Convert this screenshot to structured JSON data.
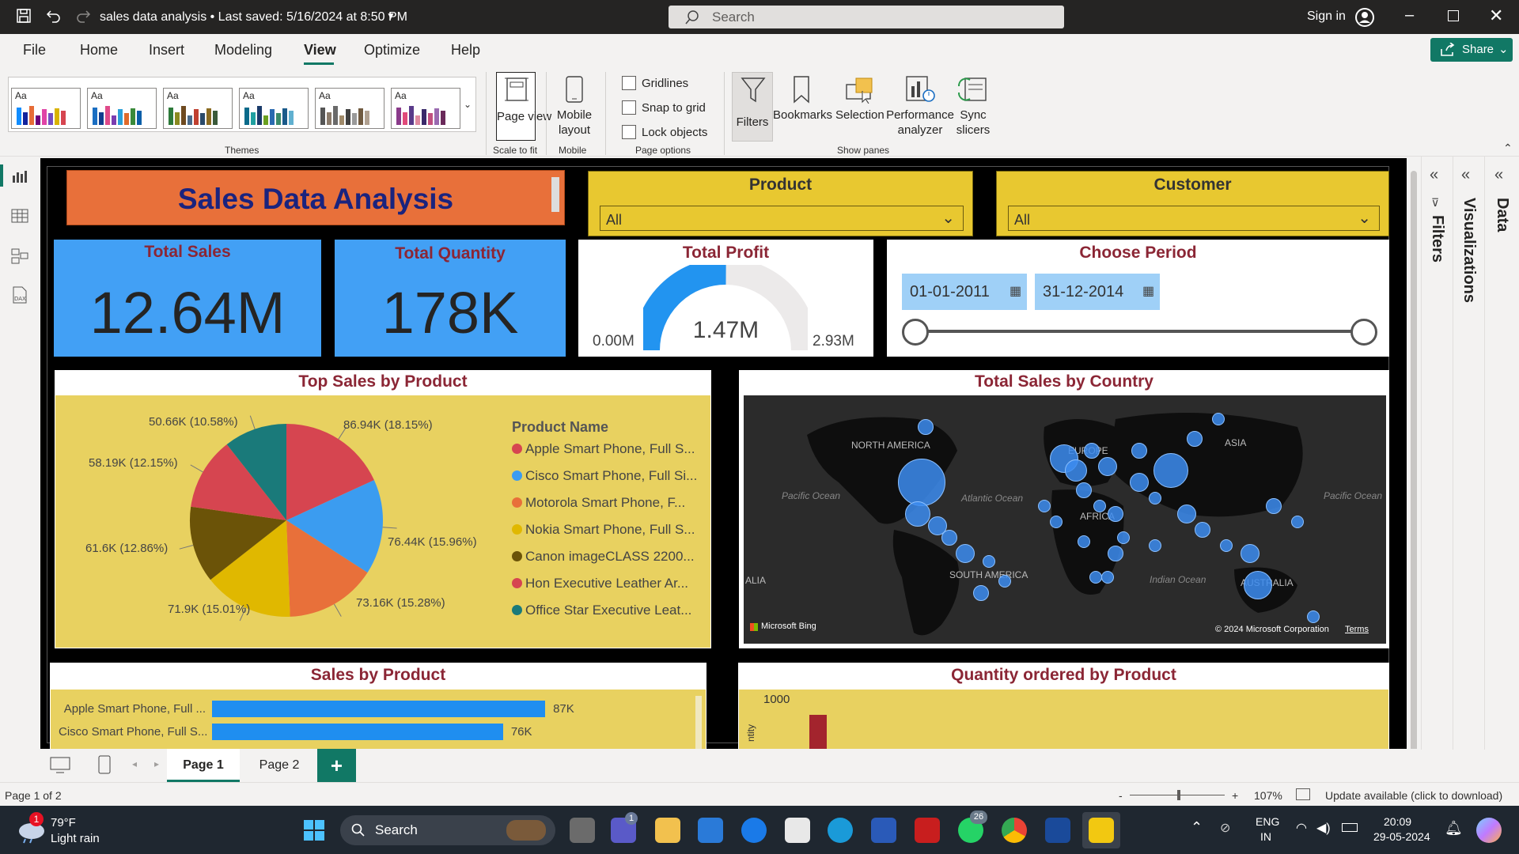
{
  "titlebar": {
    "title": "sales data analysis  •  Last saved: 5/16/2024 at 8:50 PM",
    "search_placeholder": "Search",
    "signin": "Sign in"
  },
  "menu": {
    "items": [
      "File",
      "Home",
      "Insert",
      "Modeling",
      "View",
      "Optimize",
      "Help"
    ],
    "share": "Share"
  },
  "ribbon": {
    "themes_label": "Themes",
    "theme_aa": "Aa",
    "page_view": "Page view",
    "scale_to_fit": "Scale to fit",
    "mobile_layout": "Mobile layout",
    "mobile": "Mobile",
    "gridlines": "Gridlines",
    "snap_to_grid": "Snap to grid",
    "lock_objects": "Lock objects",
    "page_options": "Page options",
    "filters": "Filters",
    "bookmarks": "Bookmarks",
    "selection": "Selection",
    "performance_analyzer": "Performance analyzer",
    "sync_slicers": "Sync slicers",
    "show_panes": "Show panes"
  },
  "report": {
    "title": "Sales Data Analysis",
    "product_slicer": {
      "label": "Product",
      "value": "All"
    },
    "customer_slicer": {
      "label": "Customer",
      "value": "All"
    },
    "total_sales": {
      "label": "Total Sales",
      "value": "12.64M"
    },
    "total_quantity": {
      "label": "Total Quantity",
      "value": "178K"
    },
    "total_profit": {
      "label": "Total Profit",
      "value": "1.47M",
      "min": "0.00M",
      "max": "2.93M",
      "fraction": 0.502
    },
    "period": {
      "label": "Choose Period",
      "start": "01-01-2011",
      "end": "31-12-2014"
    },
    "top_sales": {
      "title": "Top Sales by Product",
      "legend_title": "Product Name"
    },
    "map": {
      "title": "Total Sales by Country",
      "labels": [
        "NORTH AMERICA",
        "EUROPE",
        "ASIA",
        "AFRICA",
        "SOUTH AMERICA",
        "AUSTRALIA",
        "Pacific Ocean",
        "Atlantic Ocean",
        "Indian Ocean",
        "Pacific Ocean",
        "ALIA"
      ],
      "bing": "Microsoft Bing",
      "copyright": "© 2024 Microsoft Corporation",
      "terms": "Terms"
    },
    "sales_by_product": {
      "title": "Sales by Product"
    },
    "qty_by_product": {
      "title": "Quantity ordered by Product",
      "axis_tick": "1000",
      "axis_label": "ntity"
    }
  },
  "chart_data": [
    {
      "type": "pie",
      "title": "Top Sales by Product",
      "legend_title": "Product Name",
      "categories": [
        "Apple Smart Phone, Full S...",
        "Cisco Smart Phone, Full Si...",
        "Motorola Smart Phone, F...",
        "Nokia Smart Phone, Full S...",
        "Canon imageCLASS 2200...",
        "Hon Executive Leather Ar...",
        "Office Star Executive Leat..."
      ],
      "values": [
        86.94,
        76.44,
        73.16,
        71.9,
        61.6,
        58.19,
        50.66
      ],
      "labels": [
        "86.94K (18.15%)",
        "76.44K (15.96%)",
        "73.16K (15.28%)",
        "71.9K (15.01%)",
        "61.6K (12.86%)",
        "58.19K (12.15%)",
        "50.66K (10.58%)"
      ],
      "colors": [
        "#d64550",
        "#3b9cf0",
        "#e8703a",
        "#e0b800",
        "#6b5308",
        "#d64550",
        "#1a7a7a"
      ]
    },
    {
      "type": "bar",
      "title": "Sales by Product",
      "categories": [
        "Apple Smart Phone, Full ...",
        "Cisco Smart Phone, Full S..."
      ],
      "values": [
        87,
        76
      ],
      "labels": [
        "87K",
        "76K"
      ],
      "xlim": [
        0,
        100
      ]
    }
  ],
  "pagetabs": {
    "page1": "Page 1",
    "page2": "Page 2",
    "add": "+"
  },
  "status": {
    "page": "Page 1 of 2",
    "zoom": "107%",
    "update": "Update available (click to download)",
    "minus": "-",
    "plus": "+"
  },
  "taskbar": {
    "temp": "79°F",
    "weather": "Light rain",
    "weather_badge": "1",
    "search": "Search",
    "lang1": "ENG",
    "lang2": "IN",
    "time": "20:09",
    "date": "29-05-2024",
    "teams_badge": "1",
    "whatsapp_badge": "26"
  }
}
